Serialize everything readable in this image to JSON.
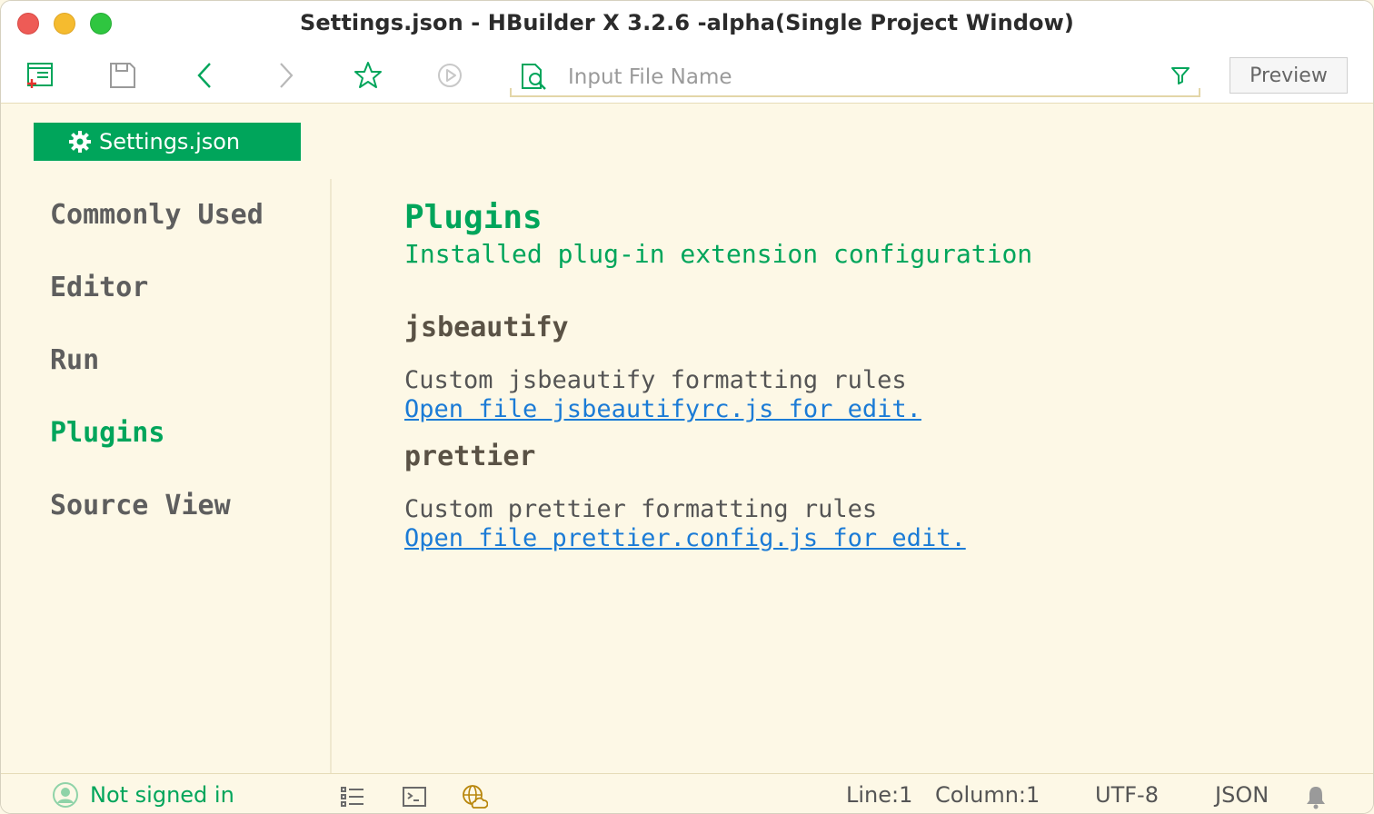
{
  "window": {
    "title": "Settings.json - HBuilder X 3.2.6 -alpha(Single Project Window)"
  },
  "toolbar": {
    "icons": [
      "new-file-icon",
      "save-icon",
      "back-icon",
      "forward-icon",
      "favorite-icon",
      "run-icon"
    ],
    "search_placeholder": "Input File Name",
    "preview_label": "Preview"
  },
  "tab": {
    "label": "Settings.json",
    "icon": "gear-icon"
  },
  "nav": {
    "items": [
      {
        "label": "Commonly Used"
      },
      {
        "label": "Editor"
      },
      {
        "label": "Run"
      },
      {
        "label": "Plugins"
      },
      {
        "label": "Source View"
      }
    ],
    "active": "Plugins"
  },
  "main": {
    "title": "Plugins",
    "subtitle": "Installed plug-in extension configuration",
    "plugins": [
      {
        "name": "jsbeautify",
        "description": "Custom jsbeautify formatting rules",
        "link": "Open file jsbeautifyrc.js for edit."
      },
      {
        "name": "prettier",
        "description": "Custom prettier formatting rules",
        "link": "Open file prettier.config.js for edit."
      }
    ]
  },
  "statusbar": {
    "signin": "Not signed in",
    "line": "Line:1",
    "column": "Column:1",
    "encoding": "UTF-8",
    "language": "JSON"
  },
  "colors": {
    "accent": "#00a55b",
    "background": "#fdf8e6",
    "link": "#1b7bd6"
  }
}
